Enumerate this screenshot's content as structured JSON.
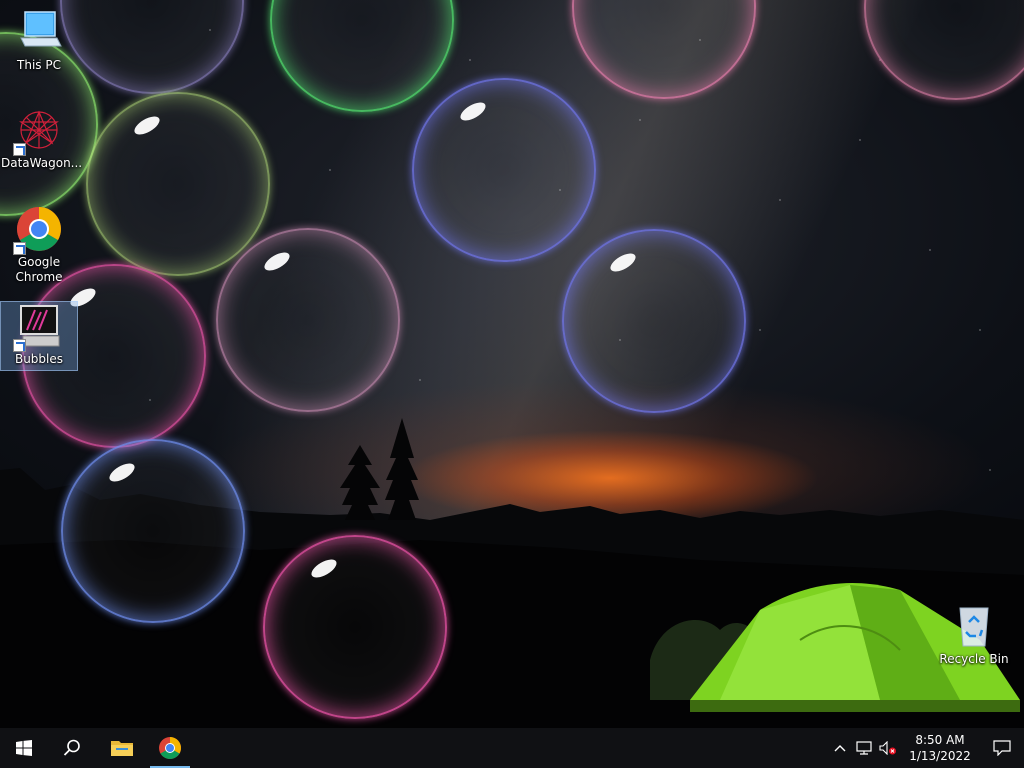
{
  "desktop": {
    "icons": [
      {
        "label": "This PC",
        "icon": "this-pc-icon"
      },
      {
        "label": "DataWagon...",
        "icon": "datawagon-icon"
      },
      {
        "label": "Google Chrome",
        "icon": "chrome-icon"
      },
      {
        "label": "Bubbles",
        "icon": "bubbles-icon",
        "selected": true
      },
      {
        "label": "Recycle Bin",
        "icon": "recycle-bin-icon"
      }
    ]
  },
  "bubbles_screensaver": {
    "colors": [
      "#8a7fc0",
      "#4fd36a",
      "#e07aa8",
      "#d67aa0",
      "#88e06a",
      "#b6e07a",
      "#6f74e8",
      "#c88ab0",
      "#e050a0",
      "#6f8ff0",
      "#e050a0"
    ]
  },
  "taskbar": {
    "start": "windows-start-icon",
    "search": "search-icon",
    "pinned": [
      {
        "name": "file-explorer",
        "icon": "folder-icon",
        "active": false
      },
      {
        "name": "google-chrome",
        "icon": "chrome-icon",
        "active": true
      }
    ],
    "tray": {
      "show_hidden": "chevron-up-icon",
      "network": "network-icon",
      "volume": "volume-muted-icon",
      "time": "8:50 AM",
      "date": "1/13/2022",
      "notifications": "action-center-icon"
    }
  },
  "colors": {
    "taskbar_bg": "#101114",
    "active_indicator": "#76b9ed",
    "tent_green": "#7ed321",
    "sunset_orange": "#ff7a1e"
  }
}
